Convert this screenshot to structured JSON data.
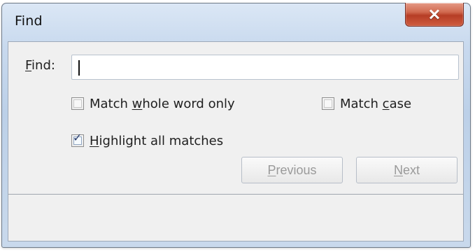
{
  "window": {
    "title": "Find",
    "close_icon": "close-icon"
  },
  "find": {
    "label_prefix": "F",
    "label_suffix": "ind:",
    "input_value": ""
  },
  "options": [
    {
      "label_prefix": "Match ",
      "label_accelerator": "w",
      "label_suffix": "hole word only",
      "checked": false
    },
    {
      "label_prefix": "Match ",
      "label_accelerator": "c",
      "label_suffix": "ase",
      "checked": false
    },
    {
      "label_prefix": "",
      "label_accelerator": "H",
      "label_suffix": "ighlight all matches",
      "checked": true
    }
  ],
  "buttons": {
    "previous": {
      "label_prefix": "",
      "label_accelerator": "P",
      "label_suffix": "revious",
      "enabled": false
    },
    "next": {
      "label_prefix": "",
      "label_accelerator": "N",
      "label_suffix": "ext",
      "enabled": false
    }
  },
  "colors": {
    "close_red": "#cf5d40",
    "dialog_gray": "#f0f0f0",
    "window_blue": "#c8d9ee"
  }
}
